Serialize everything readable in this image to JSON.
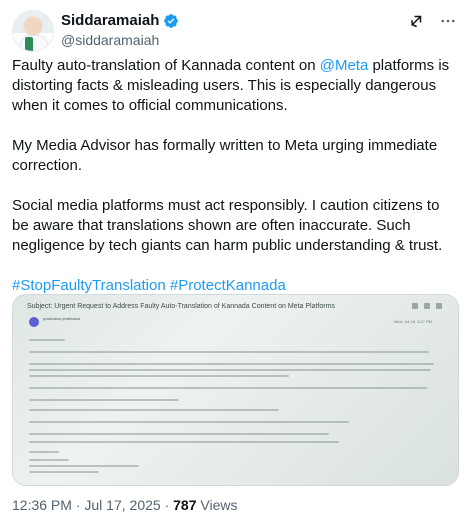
{
  "author": {
    "name": "Siddaramaiah",
    "handle": "@siddaramaiah"
  },
  "icons": [
    "avatar",
    "verified-badge-icon",
    "grok-icon",
    "more-icon"
  ],
  "colors": {
    "link": "#1d9bf0",
    "verified": "#1d9bf0",
    "muted": "#536471"
  },
  "tweet": {
    "p1_before": "Faulty auto-translation of Kannada content on ",
    "p1_mention": "@Meta",
    "p1_after": " platforms is distorting facts & misleading users. This is especially dangerous when it comes to official communications.",
    "p2": "My Media Advisor has formally written to Meta urging immediate correction.",
    "p3": "Social media platforms must act responsibly. I caution citizens to be aware that translations shown are often inaccurate. Such negligence by tech giants can harm public understanding & trust.",
    "hashtag1": "#StopFaultyTranslation",
    "hashtag2": "#ProtectKannada"
  },
  "media": {
    "subject": "Subject: Urgent Request to Address Faulty Auto-Translation of Kannada Content on Meta Platforms",
    "sender": "prabhakar prabhakar",
    "date": "Wed, Jul 16, 3:27 PM"
  },
  "footer": {
    "time": "12:36 PM",
    "separator1": " · ",
    "date": "Jul 17, 2025",
    "separator2": " · ",
    "views_count": "787",
    "views_label": " Views"
  }
}
